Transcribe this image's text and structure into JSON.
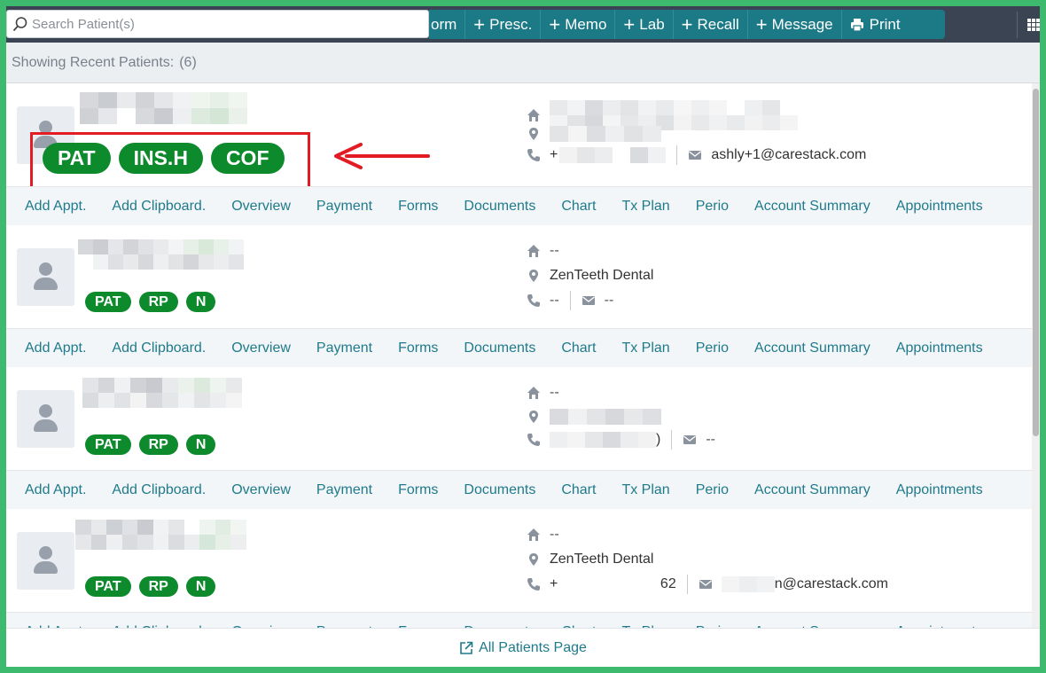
{
  "search": {
    "placeholder": "Search Patient(s)"
  },
  "toolbar": {
    "items": [
      {
        "label": "orm",
        "icon": ""
      },
      {
        "label": "Presc.",
        "icon": "plus-icon"
      },
      {
        "label": "Memo",
        "icon": "plus-icon"
      },
      {
        "label": "Lab",
        "icon": "plus-icon"
      },
      {
        "label": "Recall",
        "icon": "plus-icon"
      },
      {
        "label": "Message",
        "icon": "plus-icon"
      },
      {
        "label": "Print",
        "icon": "print-icon"
      }
    ]
  },
  "showing": {
    "label": "Showing Recent Patients:",
    "count": "(6)"
  },
  "patients": [
    {
      "badges": [
        "PAT",
        "INS.H",
        "COF"
      ],
      "address": "",
      "location": "",
      "phone": "+",
      "email": "ashly+1@carestack.com"
    },
    {
      "badges": [
        "PAT",
        "RP",
        "N"
      ],
      "address": "--",
      "location": "ZenTeeth Dental",
      "phone": "--",
      "email": "--"
    },
    {
      "badges": [
        "PAT",
        "RP",
        "N"
      ],
      "address": "--",
      "location": "",
      "phone": ")",
      "email": "--"
    },
    {
      "badges": [
        "PAT",
        "RP",
        "N"
      ],
      "address": "--",
      "location": "ZenTeeth Dental",
      "phone": "+                          62",
      "email": "n@carestack.com"
    }
  ],
  "actions": [
    "Add Appt.",
    "Add Clipboard.",
    "Overview",
    "Payment",
    "Forms",
    "Documents",
    "Chart",
    "Tx Plan",
    "Perio",
    "Account Summary",
    "Appointments"
  ],
  "footer": {
    "link": "All Patients Page"
  },
  "colors": {
    "accent": "#1c7a86",
    "badge": "#0d8a2c",
    "highlight": "#e31b23",
    "border": "#3dba6e"
  }
}
